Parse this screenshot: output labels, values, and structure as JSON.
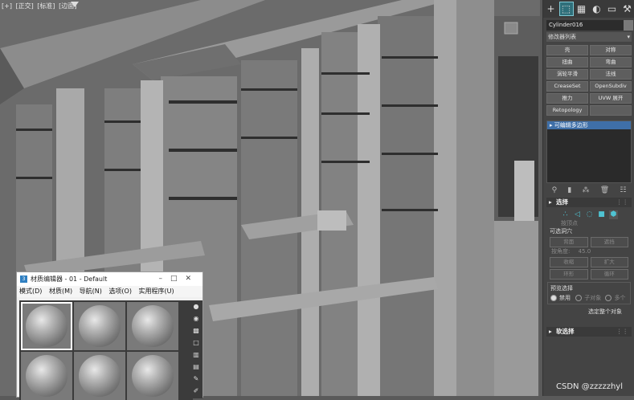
{
  "viewport": {
    "labels": [
      "[+]",
      "[正交]",
      "[标准]",
      "[边面]"
    ],
    "filter_icon": "funnel-icon"
  },
  "command_panel": {
    "tabs": [
      {
        "name": "create-icon",
        "glyph": "+"
      },
      {
        "name": "modify-icon",
        "glyph": "⬚"
      },
      {
        "name": "hierarchy-icon",
        "glyph": "▦"
      },
      {
        "name": "motion-icon",
        "glyph": "◐"
      },
      {
        "name": "display-icon",
        "glyph": "▭"
      },
      {
        "name": "utilities-icon",
        "glyph": "⚒"
      }
    ],
    "object_name": "Cylinder016",
    "modifier_list_label": "修改器列表",
    "modifier_buttons": [
      "壳",
      "对称",
      "扭曲",
      "弯曲",
      "涡轮平滑",
      "法线",
      "CreaseSet",
      "OpenSubdiv",
      "推力",
      "UVW 展开",
      "Retopology",
      ""
    ],
    "stack_item": "可编辑多边形",
    "selection_rollout": {
      "title": "选择",
      "by_vertex": "按顶点",
      "selectable_label": "可选洞穴",
      "back_button": "背面",
      "occlusion_button": "遮挡",
      "by_angle_label": "按角度:",
      "angle_value": "45.0",
      "shrink_button": "收缩",
      "grow_button": "扩大",
      "ring_button": "环形",
      "loop_button": "循环",
      "preview_label": "预览选择",
      "disable_option": "禁用",
      "subobject_option": "子对象",
      "multi_option": "多个",
      "select_whole": "选定整个对象"
    },
    "soft_selection_title": "软选择",
    "watermark": "CSDN @zzzzzhyl"
  },
  "material_editor": {
    "title": "材质编辑器 - 01 - Default",
    "menu": [
      "模式(D)",
      "材质(M)",
      "导航(N)",
      "选项(O)",
      "实用程序(U)"
    ],
    "slot_count": 6
  }
}
